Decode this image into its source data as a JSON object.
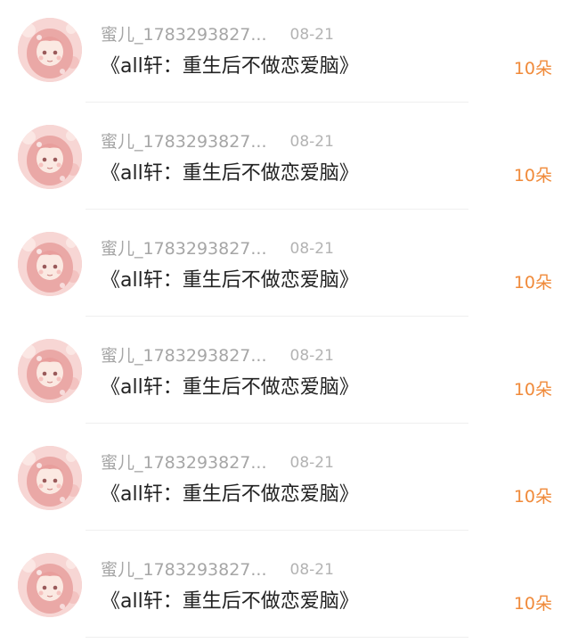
{
  "rows": [
    {
      "username": "蜜儿_1783293827...",
      "date": "08-21",
      "title": "《all轩：重生后不做恋爱脑》",
      "gift": "10朵"
    },
    {
      "username": "蜜儿_1783293827...",
      "date": "08-21",
      "title": "《all轩：重生后不做恋爱脑》",
      "gift": "10朵"
    },
    {
      "username": "蜜儿_1783293827...",
      "date": "08-21",
      "title": "《all轩：重生后不做恋爱脑》",
      "gift": "10朵"
    },
    {
      "username": "蜜儿_1783293827...",
      "date": "08-21",
      "title": "《all轩：重生后不做恋爱脑》",
      "gift": "10朵"
    },
    {
      "username": "蜜儿_1783293827...",
      "date": "08-21",
      "title": "《all轩：重生后不做恋爱脑》",
      "gift": "10朵"
    },
    {
      "username": "蜜儿_1783293827...",
      "date": "08-21",
      "title": "《all轩：重生后不做恋爱脑》",
      "gift": "10朵"
    }
  ],
  "colors": {
    "username": "#a6a6a6",
    "date": "#b3b3b3",
    "title": "#222222",
    "gift_accent": "#f08a3a",
    "divider": "#efefef"
  },
  "icons": {
    "avatar": "anime-girl-avatar"
  }
}
